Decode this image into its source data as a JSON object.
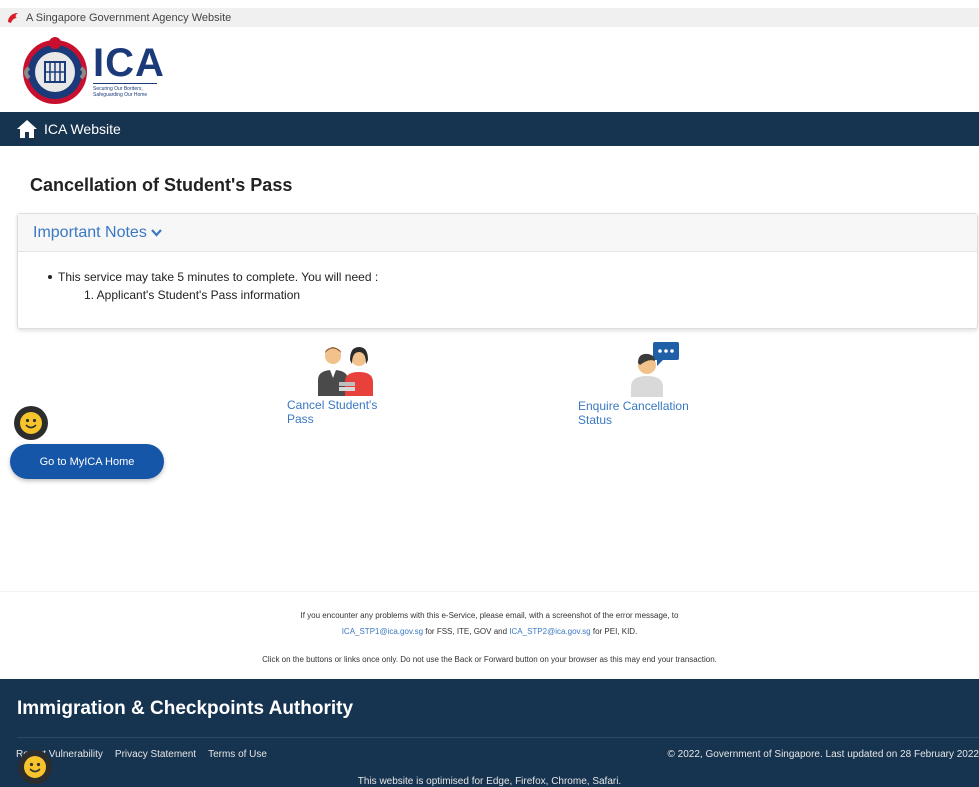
{
  "gov_bar": {
    "text": "A Singapore Government Agency Website"
  },
  "brand": {
    "name": "ICA",
    "tagline_1": "Securing Our Borders,",
    "tagline_2": "Safeguarding Our Home"
  },
  "navbar": {
    "home_label": "ICA Website"
  },
  "page": {
    "title": "Cancellation of Student's Pass"
  },
  "notes": {
    "heading": "Important Notes",
    "bullet": "This service may take 5 minutes to complete. You will need :",
    "items": [
      "1. Applicant's Student's Pass information"
    ]
  },
  "services": {
    "cancel_label": "Cancel Student's Pass",
    "enquire_label": "Enquire Cancellation Status"
  },
  "myica_button": {
    "label": "Go to MyICA Home"
  },
  "help": {
    "line1": "If you encounter any problems with this e-Service, please email, with a screenshot of the error message, to",
    "email1": "ICA_STP1@ica.gov.sg",
    "for1": " for FSS, ITE, GOV and ",
    "email2": "ICA_STP2@ica.gov.sg",
    "for2": " for PEI, KID.",
    "line3": "Click on the buttons or links once only. Do not use the Back or Forward button on your browser as this may end your transaction."
  },
  "footer": {
    "title": "Immigration & Checkpoints Authority",
    "links": [
      "Report Vulnerability",
      "Privacy Statement",
      "Terms of Use"
    ],
    "copyright": "© 2022, Government of Singapore. Last updated on 28 February 2022",
    "optimised": "This website is optimised for Edge, Firefox, Chrome, Safari."
  },
  "colors": {
    "nav_bg": "#16334f",
    "link_blue": "#3a78c2",
    "button_blue": "#1556a8"
  }
}
